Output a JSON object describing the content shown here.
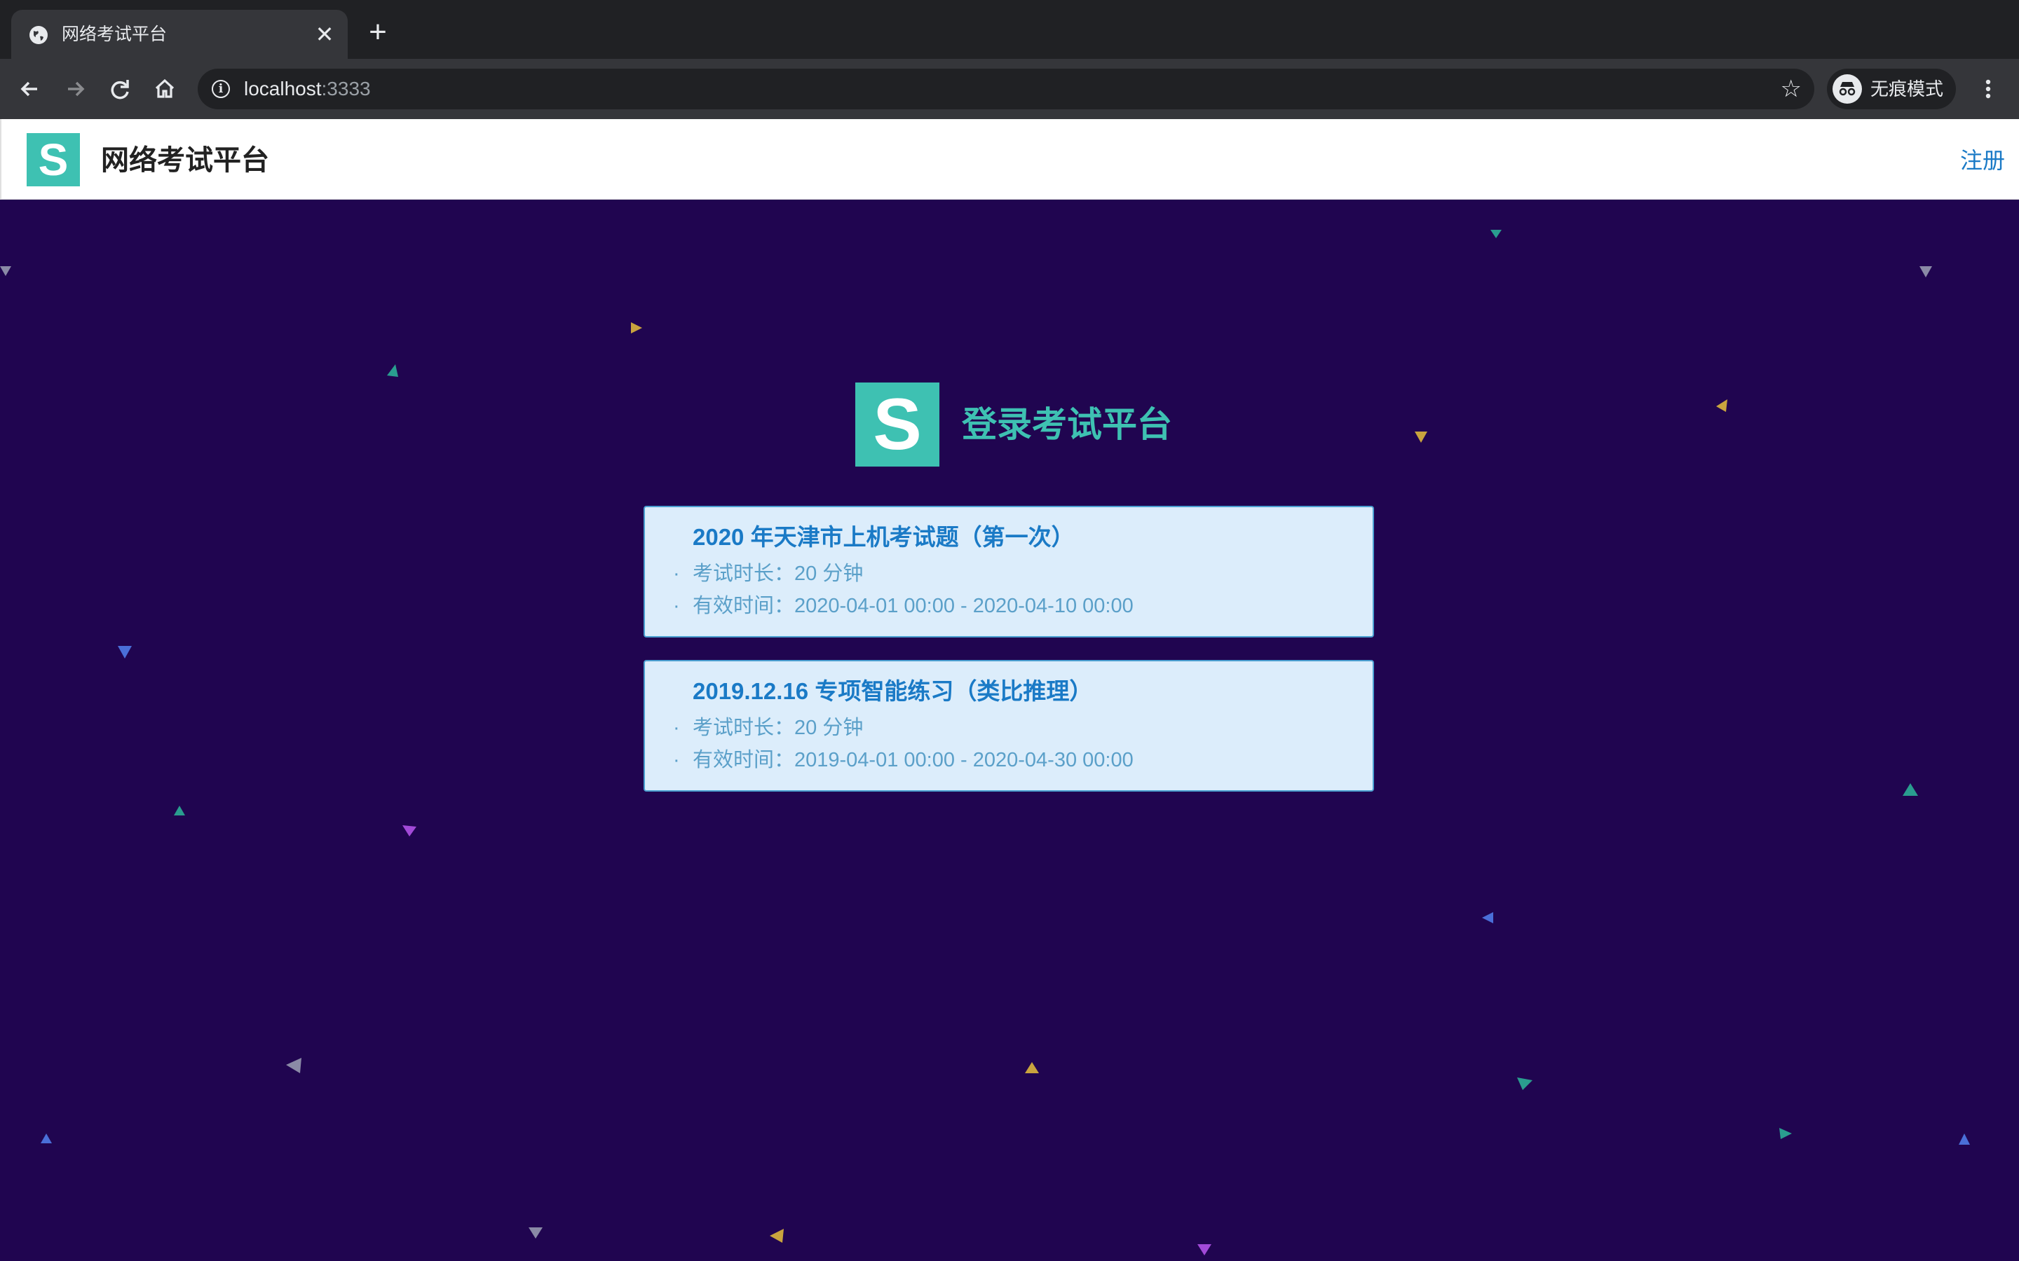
{
  "browser": {
    "tab_title": "网络考试平台",
    "tab_close": "✕",
    "new_tab": "+",
    "url_host": "localhost",
    "url_port": ":3333",
    "incognito_label": "无痕模式"
  },
  "header": {
    "logo_letter": "S",
    "site_title": "网络考试平台",
    "register": "注册"
  },
  "login": {
    "logo_letter": "S",
    "title": "登录考试平台"
  },
  "exams": [
    {
      "title": "2020 年天津市上机考试题（第一次）",
      "duration": "考试时长：20 分钟",
      "validity": "有效时间：2020-04-01 00:00 - 2020-04-10 00:00"
    },
    {
      "title": "2019.12.16 专项智能练习（类比推理）",
      "duration": "考试时长：20 分钟",
      "validity": "有效时间：2019-04-01 00:00 - 2020-04-30 00:00"
    }
  ],
  "colors": {
    "page_bg": "#200550",
    "accent": "#3ec1b2",
    "link": "#1a7ac6",
    "card_bg": "#dcedfb",
    "confetti": [
      "#c9a43e",
      "#2a9d8f",
      "#8a8aa6",
      "#4a6fd8",
      "#a24ad8",
      "#3ec1b2"
    ]
  }
}
